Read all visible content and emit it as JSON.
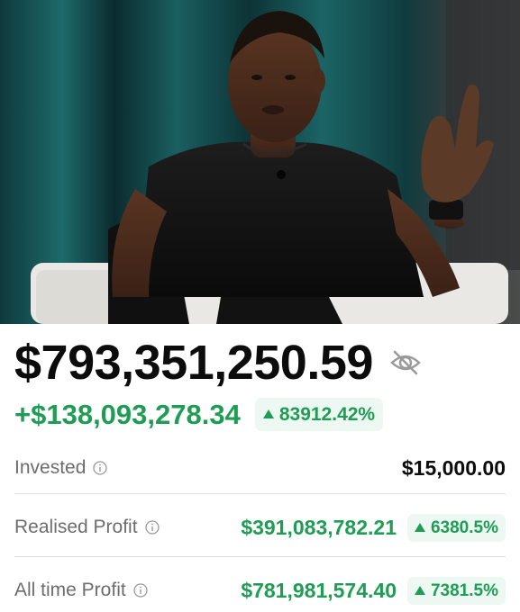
{
  "photo": {
    "subject": "man-seated-talking"
  },
  "balance": {
    "value": "$793,351,250.59",
    "hide_icon": "eye-off-icon"
  },
  "gain": {
    "value": "+$138,093,278.34",
    "percent": "83912.42%"
  },
  "stats": {
    "invested": {
      "label": "Invested",
      "value": "$15,000.00"
    },
    "realised": {
      "label": "Realised Profit",
      "value": "$391,083,782.21",
      "percent": "6380.5%"
    },
    "all_time": {
      "label": "All time Profit",
      "value": "$781,981,574.40",
      "percent": "7381.5%"
    }
  },
  "colors": {
    "positive": "#1f9d55",
    "positive_bg": "#ecf8f1",
    "text": "#0c0c0c",
    "muted": "#6d6d6d"
  }
}
